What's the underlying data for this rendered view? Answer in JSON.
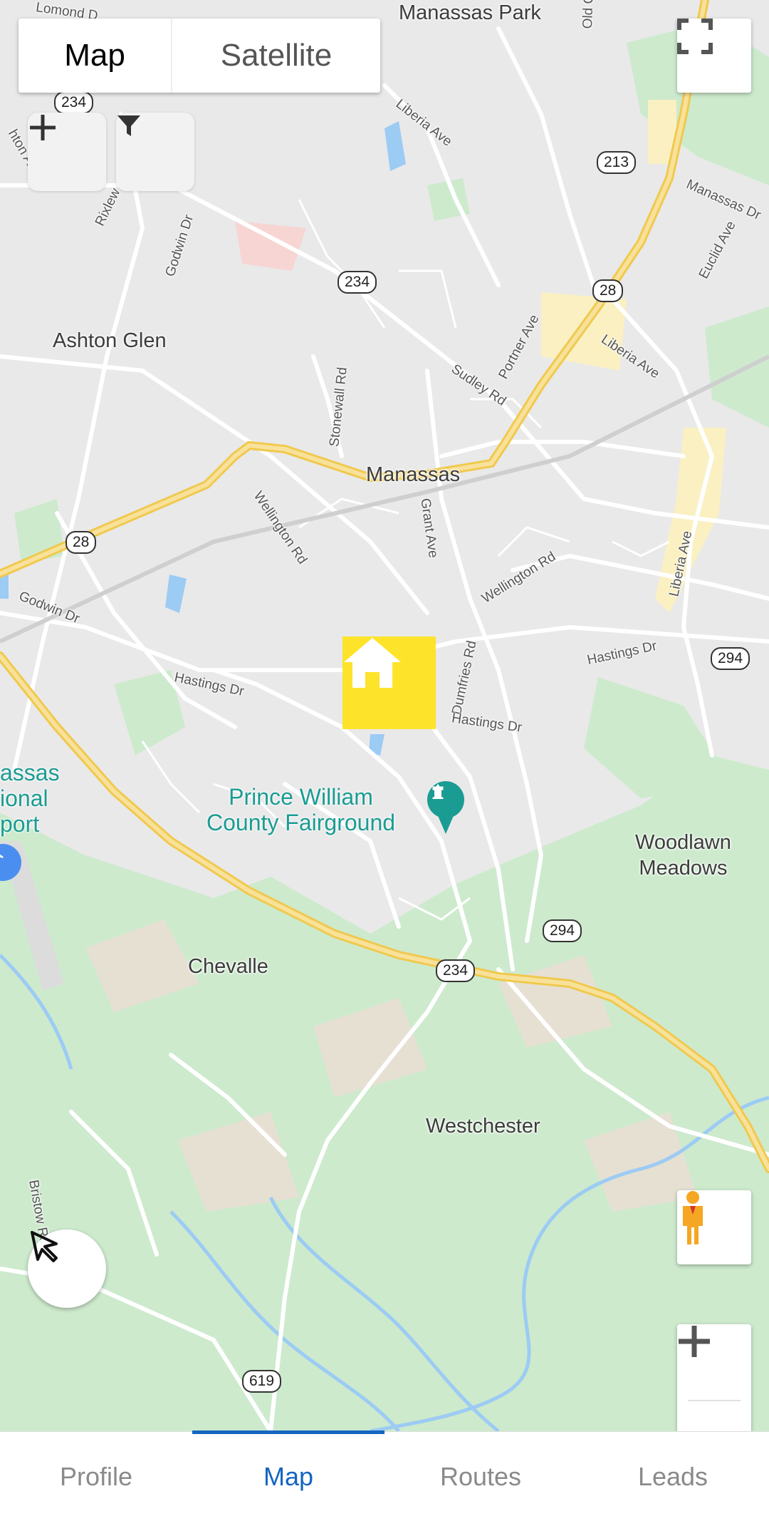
{
  "map_type": {
    "options": [
      "Map",
      "Satellite"
    ],
    "selected": "Map"
  },
  "icons": {
    "fullscreen": "fullscreen-icon",
    "add": "plus-icon",
    "filter": "filter-icon",
    "home": "home-icon",
    "pegman": "pegman-icon",
    "pointer": "cursor-arrow-icon",
    "zoom_in": "plus-icon",
    "airport": "airplane-icon",
    "poi": "fairground-icon"
  },
  "places": {
    "manassas_park": "Manassas Park",
    "ashton_glen": "Ashton Glen",
    "manassas": "Manassas",
    "woodlawn_meadows_1": "Woodlawn",
    "woodlawn_meadows_2": "Meadows",
    "chevalle": "Chevalle",
    "westchester": "Westchester",
    "airport_1": "assas",
    "airport_2": "ional",
    "airport_3": "port",
    "lomond": "Lomond D"
  },
  "poi": {
    "line1": "Prince William",
    "line2": "County Fairground"
  },
  "roads": {
    "liberia_ave": "Liberia Ave",
    "liberia_ave2": "Liberia Ave",
    "liberia_ave3": "Liberia Ave",
    "manassas_dr": "Manassas Dr",
    "euclid_ave": "Euclid Ave",
    "old_centreville": "Old Centrevill",
    "godwin_dr": "Godwin Dr",
    "godwin_dr2": "Godwin Dr",
    "rixlew": "Rixlew",
    "ashton_av": "hton Av",
    "stonewall_rd": "Stonewall Rd",
    "sudley_rd": "Sudley Rd",
    "portner_ave": "Portner Ave",
    "wellington_rd": "Wellington Rd",
    "wellington_rd2": "Wellington Rd",
    "grant_ave": "Grant Ave",
    "dumfries_rd": "Dumfries Rd",
    "hastings_dr": "Hastings Dr",
    "hastings_dr2": "Hastings Dr",
    "hastings_dr3": "Hastings Dr",
    "bristow_rd": "Bristow Rd"
  },
  "shields": {
    "s234a": "234",
    "s213": "213",
    "s234b": "234",
    "s28a": "28",
    "s28b": "28",
    "s294a": "294",
    "s294b": "294",
    "s234c": "234",
    "s619": "619"
  },
  "nav": {
    "tabs": [
      "Profile",
      "Map",
      "Routes",
      "Leads"
    ],
    "active": "Map"
  },
  "colors": {
    "accent": "#1565c0",
    "home_marker": "#fde42a",
    "highway": "#f5d57a",
    "park": "#cdeacd",
    "water": "#9ccbf4"
  }
}
